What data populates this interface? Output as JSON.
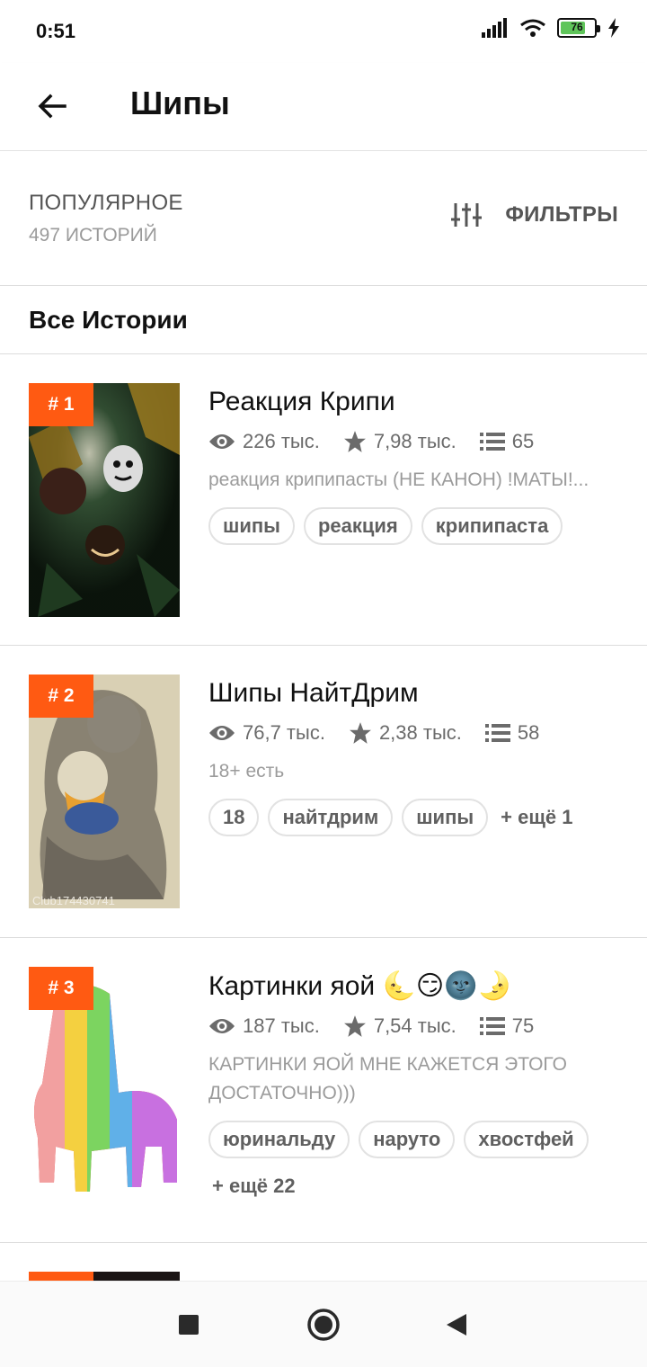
{
  "status_bar": {
    "time": "0:51",
    "battery": "76"
  },
  "header": {
    "title": "Шипы"
  },
  "filter_bar": {
    "sort_label": "ПОПУЛЯРНОЕ",
    "story_count": "497 ИСТОРИЙ",
    "filters_label": "ФИЛЬТРЫ"
  },
  "section": {
    "title": "Все Истории"
  },
  "stories": [
    {
      "rank": "# 1",
      "title": "Реакция Крипи",
      "views": "226 тыс.",
      "votes": "7,98 тыс.",
      "parts": "65",
      "description": "реакция  крипипасты (НЕ КАНОН) !МАТЫ!...",
      "tags": [
        "шипы",
        "реакция",
        "крипипаста"
      ],
      "more": ""
    },
    {
      "rank": "# 2",
      "title": "Шипы НайтДрим",
      "views": "76,7 тыс.",
      "votes": "2,38 тыс.",
      "parts": "58",
      "description": "18+ есть",
      "tags": [
        "18",
        "найтдрим",
        "шипы"
      ],
      "more": "+ ещё 1"
    },
    {
      "rank": "# 3",
      "title": "Картинки яой 🌜😏🌚🌛",
      "views": "187 тыс.",
      "votes": "7,54 тыс.",
      "parts": "75",
      "description": "КАРТИНКИ ЯОЙ МНЕ КАЖЕТСЯ ЭТОГО ДОСТАТОЧНО)))",
      "tags": [
        "юринальду",
        "наруто",
        "хвостфей"
      ],
      "more": "+ ещё 22"
    }
  ],
  "colors": {
    "accent": "#ff5a12",
    "tag_border": "#e2e2e2",
    "muted_text": "#9b9b9b"
  },
  "icons": {
    "back": "arrow-left-icon",
    "filters": "sliders-icon",
    "views": "eye-icon",
    "votes": "star-icon",
    "parts": "list-icon",
    "nav_recents": "square-icon",
    "nav_home": "circle-icon",
    "nav_back": "triangle-icon"
  }
}
